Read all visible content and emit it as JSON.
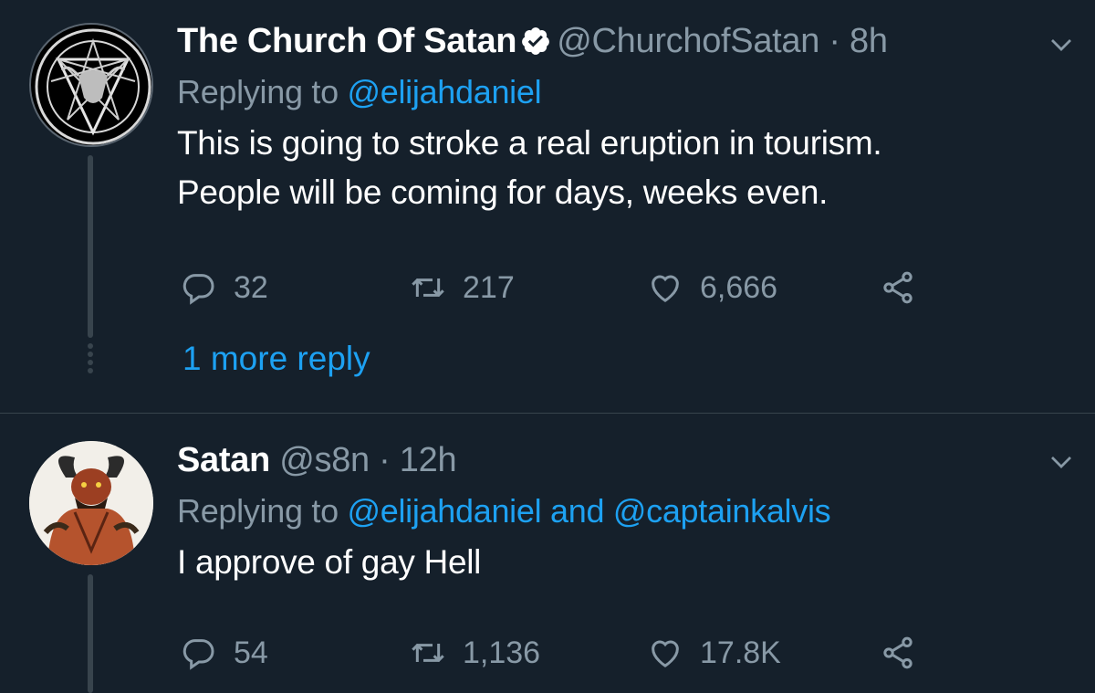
{
  "tweets": [
    {
      "name": "The Church Of Satan",
      "verified": true,
      "handle": "@ChurchofSatan",
      "separator": "·",
      "time": "8h",
      "replying_prefix": "Replying to",
      "replying_mentions": [
        "@elijahdaniel"
      ],
      "replying_joiner": "",
      "text_lines": [
        "This is going to stroke a real eruption in tourism.",
        "People will be coming for days, weeks even."
      ],
      "replies": "32",
      "retweets": "217",
      "likes": "6,666",
      "more_replies": "1 more reply"
    },
    {
      "name": "Satan",
      "verified": false,
      "handle": "@s8n",
      "separator": "·",
      "time": "12h",
      "replying_prefix": "Replying to",
      "replying_mentions": [
        "@elijahdaniel",
        "@captainkalvis"
      ],
      "replying_joiner": "and",
      "text_lines": [
        "I approve of gay Hell"
      ],
      "replies": "54",
      "retweets": "1,136",
      "likes": "17.8K"
    }
  ],
  "colors": {
    "background": "#15202b",
    "divider": "#38444d",
    "secondary_text": "#8899a6",
    "accent": "#1da1f2",
    "primary_text": "#ffffff"
  },
  "icons": [
    "reply-icon",
    "retweet-icon",
    "like-icon",
    "share-icon",
    "chevron-down-icon",
    "verified-badge-icon"
  ]
}
